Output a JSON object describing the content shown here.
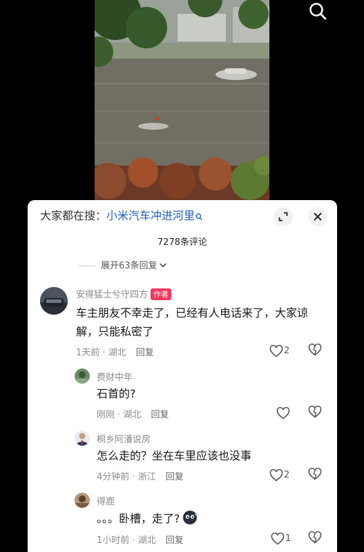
{
  "search_bar": {
    "prefix": "大家都在搜：",
    "term": "小米汽车冲进河里"
  },
  "comments_header": {
    "count": "7278条评论",
    "expand_replies": "展开63条回复"
  },
  "comments": [
    {
      "user": "安得猛士兮守四方",
      "badge": "作者",
      "text": "车主朋友不幸走了，已经有人电话来了，大家谅解，只能私密了",
      "time": "1天前",
      "location": "湖北",
      "reply": "回复",
      "likes": "2"
    },
    {
      "user": "费财中年",
      "text": "石首的?",
      "time": "刚刚",
      "location": "湖北",
      "reply": "回复",
      "likes": ""
    },
    {
      "user": "桐乡阿潘说房",
      "text": "怎么走的？坐在车里应该也没事",
      "time": "4分钟前",
      "location": "浙江",
      "reply": "回复",
      "likes": "2"
    },
    {
      "user": "得鹿",
      "text": "。。。卧槽，走了?",
      "time": "1小时前",
      "location": "湖北",
      "reply": "回复",
      "likes": "1"
    }
  ],
  "colors": {
    "search_term": "#1e5fb8",
    "author_badge": "#f5365c",
    "sheet_bg": "#ffffff",
    "page_bg": "#000000"
  },
  "icons": {
    "top_search": "search-icon",
    "expand": "expand-diagonal-icon",
    "close": "close-icon",
    "like": "heart-icon",
    "dislike": "broken-heart-icon"
  }
}
